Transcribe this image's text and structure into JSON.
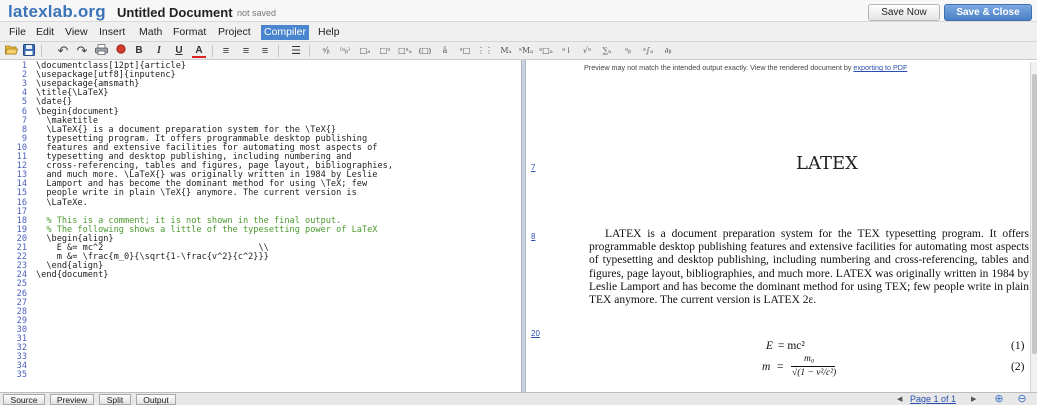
{
  "header": {
    "logo": "latexlab.org",
    "doc_title": "Untitled Document",
    "status": "not saved",
    "save_label": "Save Now",
    "save_close_label": "Save & Close"
  },
  "menubar": {
    "items": [
      "File",
      "Edit",
      "View",
      "Insert",
      "Math",
      "Format",
      "Project",
      "Compiler",
      "Help"
    ],
    "active": "Compiler"
  },
  "toolbar": {
    "icons": [
      "folder-open-icon",
      "save-disk-icon",
      "undo-icon",
      "redo-icon",
      "print-icon",
      "compile-icon",
      "bold-icon",
      "italic-icon",
      "underline-icon",
      "text-color-icon",
      "align-left-icon",
      "align-center-icon",
      "align-right-icon",
      "bullet-list-icon",
      "fraction-icon",
      "binomial-icon",
      "subscript-icon",
      "superscript-icon",
      "sub-superscript-icon",
      "over-under-icon",
      "accent-icon",
      "overline-icon",
      "matrix-icon",
      "mid-index-icon",
      "double-sub-icon",
      "arrow-vector-icon",
      "sqrt-icon",
      "sum-icon",
      "integral-icon",
      "prod-icon",
      "misc-symbol-icon"
    ],
    "bold": "B",
    "italic": "I",
    "underline": "U",
    "text_color": "A"
  },
  "editor": {
    "lines": [
      {
        "num": "1",
        "text": "\\documentclass[12pt]{article}",
        "comment": false
      },
      {
        "num": "2",
        "text": "\\usepackage[utf8]{inputenc}",
        "comment": false
      },
      {
        "num": "3",
        "text": "\\usepackage{amsmath}",
        "comment": false
      },
      {
        "num": "4",
        "text": "\\title{\\LaTeX}",
        "comment": false
      },
      {
        "num": "5",
        "text": "\\date{}",
        "comment": false
      },
      {
        "num": "6",
        "text": "\\begin{document}",
        "comment": false
      },
      {
        "num": "7",
        "text": "  \\maketitle",
        "comment": false
      },
      {
        "num": "8",
        "text": "  \\LaTeX{} is a document preparation system for the \\TeX{}",
        "comment": false
      },
      {
        "num": "9",
        "text": "  typesetting program. It offers programmable desktop publishing",
        "comment": false
      },
      {
        "num": "10",
        "text": "  features and extensive facilities for automating most aspects of",
        "comment": false
      },
      {
        "num": "11",
        "text": "  typesetting and desktop publishing, including numbering and",
        "comment": false
      },
      {
        "num": "12",
        "text": "  cross-referencing, tables and figures, page layout, bibliographies,",
        "comment": false
      },
      {
        "num": "13",
        "text": "  and much more. \\LaTeX{} was originally written in 1984 by Leslie",
        "comment": false
      },
      {
        "num": "14",
        "text": "  Lamport and has become the dominant method for using \\TeX; few",
        "comment": false
      },
      {
        "num": "15",
        "text": "  people write in plain \\TeX{} anymore. The current version is",
        "comment": false
      },
      {
        "num": "16",
        "text": "  \\LaTeXe.",
        "comment": false
      },
      {
        "num": "17",
        "text": "",
        "comment": false
      },
      {
        "num": "18",
        "text": "  % This is a comment; it is not shown in the final output.",
        "comment": true
      },
      {
        "num": "19",
        "text": "  % The following shows a little of the typesetting power of LaTeX",
        "comment": true
      },
      {
        "num": "20",
        "text": "  \\begin{align}",
        "comment": false
      },
      {
        "num": "21",
        "text": "    E &= mc^2                              \\\\",
        "comment": false
      },
      {
        "num": "22",
        "text": "    m &= \\frac{m_0}{\\sqrt{1-\\frac{v^2}{c^2}}}",
        "comment": false
      },
      {
        "num": "23",
        "text": "  \\end{align}",
        "comment": false
      },
      {
        "num": "24",
        "text": "\\end{document}",
        "comment": false
      },
      {
        "num": "25",
        "text": "",
        "comment": false
      },
      {
        "num": "26",
        "text": "",
        "comment": false
      },
      {
        "num": "27",
        "text": "",
        "comment": false
      },
      {
        "num": "28",
        "text": "",
        "comment": false
      },
      {
        "num": "29",
        "text": "",
        "comment": false
      },
      {
        "num": "30",
        "text": "",
        "comment": false
      },
      {
        "num": "31",
        "text": "",
        "comment": false
      },
      {
        "num": "32",
        "text": "",
        "comment": false
      },
      {
        "num": "33",
        "text": "",
        "comment": false
      },
      {
        "num": "34",
        "text": "",
        "comment": false
      },
      {
        "num": "35",
        "text": "",
        "comment": false
      }
    ]
  },
  "preview": {
    "note": "Preview may not match the intended output exactly. View the rendered document by",
    "note_link": "exporting to PDF",
    "source_links": [
      "7",
      "8",
      "20"
    ],
    "title": "LATEX",
    "paragraph": "LATEX is a document preparation system for the TEX typesetting program. It offers programmable desktop publishing features and extensive facilities for automating most aspects of typesetting and desktop publishing, including numbering and cross-referencing, tables and figures, page layout, bibliographies, and much more. LATEX was originally written in 1984 by Leslie Lamport and has become the dominant method for using TEX; few people write in plain TEX anymore. The current version is LATEX 2ε.",
    "eq1_lhs": "E",
    "eq1_rhs": "= mc²",
    "eq1_num": "(1)",
    "eq2_lhs": "m",
    "eq2_num": "(2)",
    "eq2_numer": "m₀",
    "eq2_denom": "√(1 − v²/c²)"
  },
  "bottom": {
    "tabs": [
      "Source",
      "Preview",
      "Split",
      "Output"
    ],
    "prev_arrow": "◀",
    "page_label": "Page 1 of 1",
    "next_arrow": "▶",
    "zoom_in": "⊕",
    "zoom_out": "⊖"
  }
}
